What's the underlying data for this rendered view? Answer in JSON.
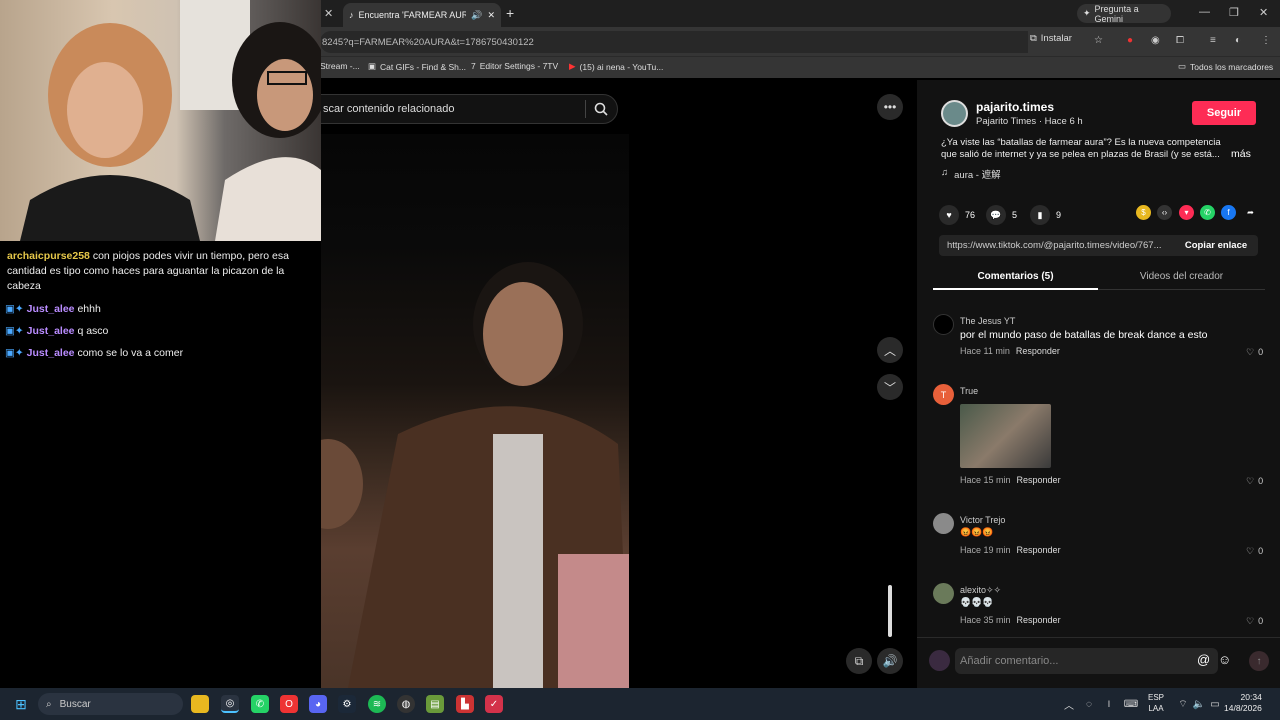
{
  "browser": {
    "tab_title": "Encuentra 'FARMEAR AURA'",
    "gemini_label": "Pregunta a Gemini",
    "url": "8245?q=FARMEAR%20AURA&t=1786750430122",
    "install_label": "Instalar",
    "bookmarks": [
      "Stream -...",
      "Cat GIFs - Find & Sh...",
      "Editor Settings - 7TV",
      "(15) ai nena - YouTu..."
    ],
    "all_bookmarks": "Todos los marcadores"
  },
  "search": {
    "placeholder": "scar contenido relacionado"
  },
  "post": {
    "username": "pajarito.times",
    "subtitle": "Pajarito Times · Hace 6 h",
    "follow_label": "Seguir",
    "description": "¿Ya viste las “batallas de farmear aura”? Es la nueva competencia que salió de internet y ya se pelea en plazas de Brasil (y se está...",
    "more_label": "más",
    "music": "aura - 遮解",
    "likes": "76",
    "comments": "5",
    "saves": "9",
    "link": "https://www.tiktok.com/@pajarito.times/video/767...",
    "copy_label": "Copiar enlace",
    "tab_comments": "Comentarios (5)",
    "tab_creator": "Videos del creador"
  },
  "comments": [
    {
      "name": "The Jesus YT",
      "text": "por el mundo paso de batallas de break dance a esto",
      "time": "Hace 11 min",
      "reply": "Responder",
      "likes": "0"
    },
    {
      "name": "True",
      "initial": "T",
      "text": "",
      "time": "Hace 15 min",
      "reply": "Responder",
      "likes": "0"
    },
    {
      "name": "Victor Trejo",
      "text": "😡😡😡",
      "time": "Hace 19 min",
      "reply": "Responder",
      "likes": "0"
    },
    {
      "name": "alexito✧✧",
      "text": "💀💀💀",
      "time": "Hace 35 min",
      "reply": "Responder",
      "likes": "0"
    }
  ],
  "add_comment_placeholder": "Añadir comentario...",
  "chat": [
    {
      "user": "archaicpurse258",
      "text": "con piojos podes vivir un tiempo, pero esa cantidad es tipo como haces para aguantar la picazon de la cabeza",
      "color": "#e6c84a"
    },
    {
      "user": "Just_alee",
      "text": "ehhh",
      "color": "#b98cff"
    },
    {
      "user": "Just_alee",
      "text": "q asco",
      "color": "#b98cff"
    },
    {
      "user": "Just_alee",
      "text": "como se lo va a comer",
      "color": "#b98cff"
    }
  ],
  "taskbar": {
    "search_label": "Buscar",
    "lang": "ESP",
    "lang2": "LAA",
    "time": "20:34",
    "date": "14/8/2026"
  },
  "colors": {
    "accent": "#fe2c55"
  }
}
